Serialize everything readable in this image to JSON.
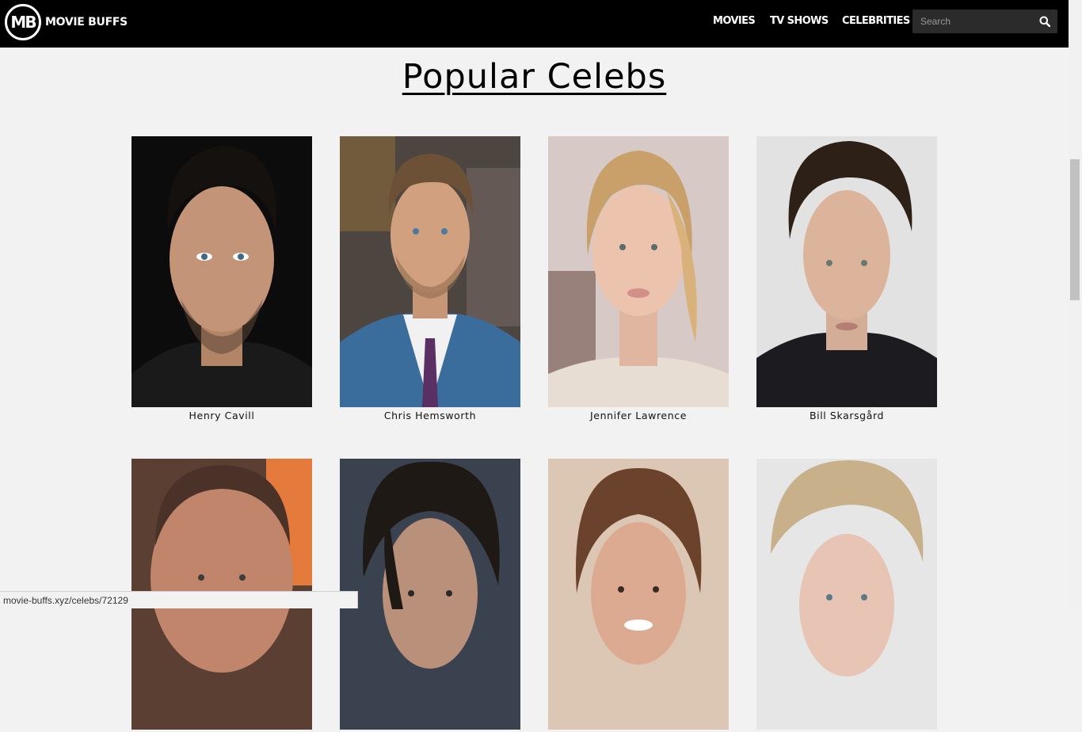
{
  "header": {
    "logo_mark": "MB",
    "logo_text": "MOVIE BUFFS",
    "nav": [
      {
        "label": "MOVIES"
      },
      {
        "label": "TV SHOWS"
      },
      {
        "label": "CELEBRITIES"
      }
    ],
    "search": {
      "placeholder": "Search",
      "icon": "search-icon"
    }
  },
  "page_title": "Popular Celebs",
  "celebs": [
    {
      "name": "Henry Cavill"
    },
    {
      "name": "Chris Hemsworth"
    },
    {
      "name": "Jennifer Lawrence"
    },
    {
      "name": "Bill Skarsgård"
    },
    {
      "name": ""
    },
    {
      "name": ""
    },
    {
      "name": ""
    },
    {
      "name": ""
    }
  ],
  "status_bar": {
    "url": "movie-buffs.xyz/celebs/72129"
  }
}
